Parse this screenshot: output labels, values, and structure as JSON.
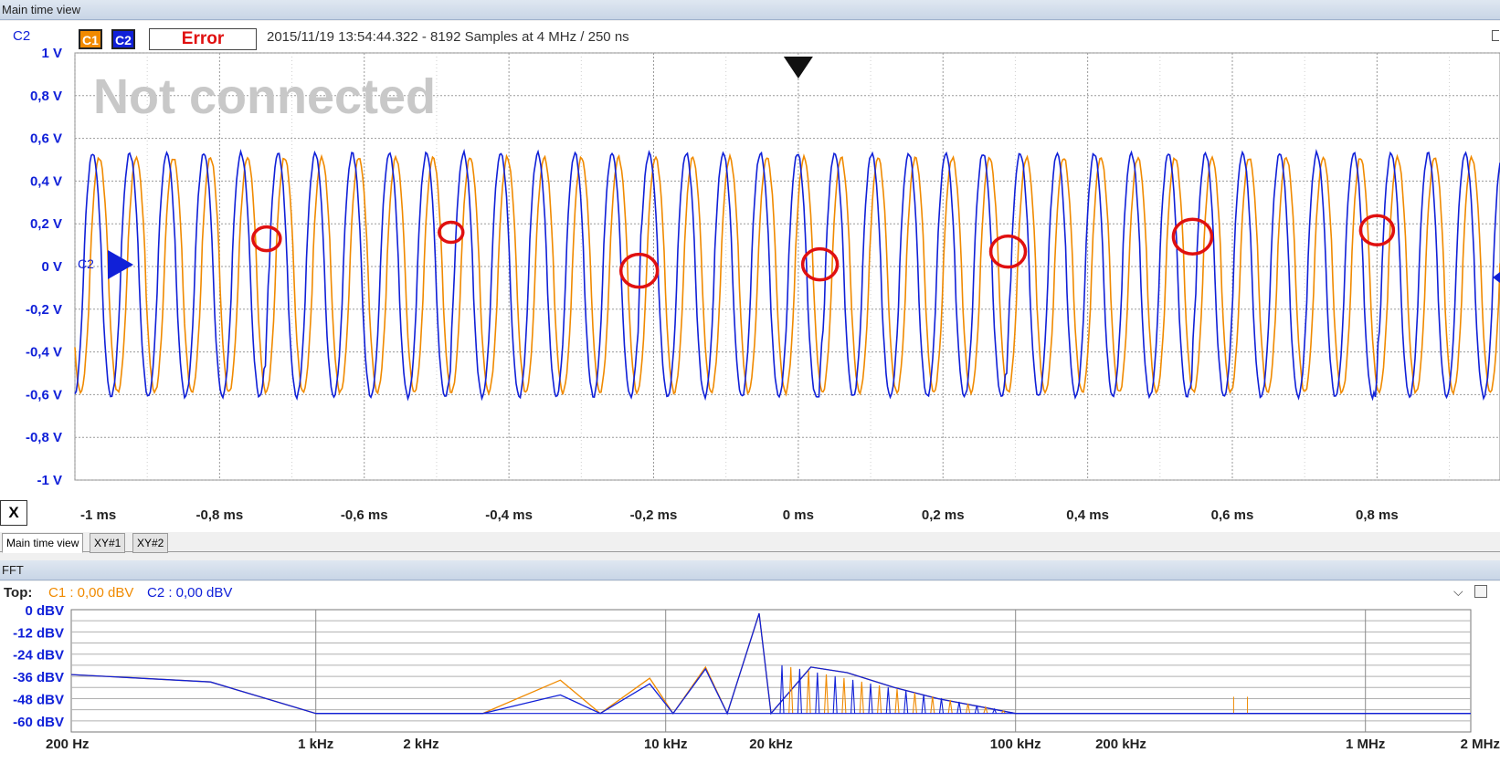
{
  "time_view": {
    "panel_title": "Main time view",
    "channel_label": "C2",
    "c1_button": "C1",
    "c2_button": "C2",
    "status": "Error",
    "info": "2015/11/19  13:54:44.322 - 8192 Samples at 4 MHz / 250 ns",
    "watermark": "Not connected",
    "marker_label": "C2",
    "x_button": "X",
    "y_ticks": [
      "1 V",
      "0,8 V",
      "0,6 V",
      "0,4 V",
      "0,2 V",
      "0 V",
      "-0,2 V",
      "-0,4 V",
      "-0,6 V",
      "-0,8 V",
      "-1 V"
    ],
    "x_ticks": [
      "-1 ms",
      "-0,8 ms",
      "-0,6 ms",
      "-0,4 ms",
      "-0,2 ms",
      "0 ms",
      "0,2 ms",
      "0,4 ms",
      "0,6 ms",
      "0,8 ms"
    ]
  },
  "tabs": [
    "Main time view",
    "XY#1",
    "XY#2"
  ],
  "fft": {
    "panel_title": "FFT",
    "top_label": "Top:",
    "c1_top": "C1 : 0,00 dBV",
    "c2_top": "C2 : 0,00 dBV",
    "y_ticks": [
      "0 dBV",
      "-12 dBV",
      "-24 dBV",
      "-36 dBV",
      "-48 dBV",
      "-60 dBV"
    ],
    "x_ticks": [
      "200 Hz",
      "1 kHz",
      "2 kHz",
      "10 kHz",
      "20 kHz",
      "100 kHz",
      "200 kHz",
      "1 MHz",
      "2 MHz"
    ]
  },
  "colors": {
    "c1": "#f08a00",
    "c2": "#1020d8",
    "error": "#e01010",
    "circle": "#e01010"
  },
  "chart_data": [
    {
      "type": "line",
      "series": [
        {
          "name": "C1",
          "amplitude_v": 0.55,
          "offset_v": -0.04,
          "approx_frequency_khz": 19.5
        },
        {
          "name": "C2",
          "amplitude_v": 0.57,
          "offset_v": -0.04,
          "approx_frequency_khz": 19.5
        }
      ],
      "xlim_ms": [
        -1,
        0.97
      ],
      "ylim_v": [
        -1,
        1
      ],
      "annotations": [
        {
          "type": "circle",
          "t_ms": -0.735,
          "v": 0.13
        },
        {
          "type": "circle",
          "t_ms": -0.48,
          "v": 0.16
        },
        {
          "type": "circle",
          "t_ms": -0.22,
          "v": -0.02
        },
        {
          "type": "circle",
          "t_ms": 0.03,
          "v": 0.01
        },
        {
          "type": "circle",
          "t_ms": 0.29,
          "v": 0.07
        },
        {
          "type": "circle",
          "t_ms": 0.545,
          "v": 0.14
        },
        {
          "type": "circle",
          "t_ms": 0.8,
          "v": 0.17
        }
      ]
    },
    {
      "type": "line",
      "xscale": "log",
      "xlim_hz": [
        200,
        2000000
      ],
      "ylim_dbv": [
        -66,
        0
      ],
      "series": [
        {
          "name": "C1",
          "points_hz_dbv": [
            [
              200,
              -35
            ],
            [
              500,
              -39
            ],
            [
              1000,
              -56
            ],
            [
              3000,
              -56
            ],
            [
              5000,
              -38
            ],
            [
              6500,
              -56
            ],
            [
              9000,
              -37
            ],
            [
              10500,
              -56
            ],
            [
              13000,
              -31
            ],
            [
              15000,
              -56
            ],
            [
              18500,
              -2
            ],
            [
              20000,
              -56
            ],
            [
              26000,
              -31
            ],
            [
              33000,
              -34
            ],
            [
              45000,
              -42
            ],
            [
              60000,
              -48
            ],
            [
              100000,
              -56
            ],
            [
              1000000,
              -56
            ],
            [
              2000000,
              -56
            ]
          ]
        },
        {
          "name": "C2",
          "points_hz_dbv": [
            [
              200,
              -35
            ],
            [
              500,
              -39
            ],
            [
              1000,
              -56
            ],
            [
              3000,
              -56
            ],
            [
              5000,
              -46
            ],
            [
              6500,
              -56
            ],
            [
              9000,
              -40
            ],
            [
              10500,
              -56
            ],
            [
              13000,
              -32
            ],
            [
              15000,
              -56
            ],
            [
              18500,
              -2
            ],
            [
              20000,
              -56
            ],
            [
              26000,
              -31
            ],
            [
              33000,
              -34
            ],
            [
              45000,
              -42
            ],
            [
              60000,
              -48
            ],
            [
              100000,
              -56
            ],
            [
              1000000,
              -56
            ],
            [
              2000000,
              -56
            ]
          ]
        }
      ]
    }
  ]
}
